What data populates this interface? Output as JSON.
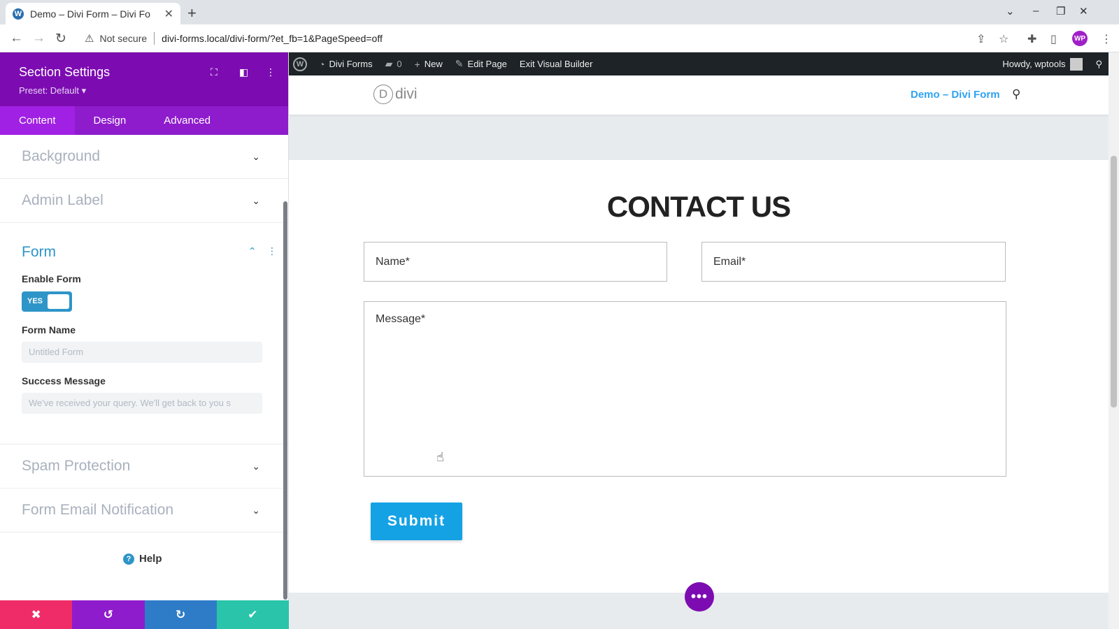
{
  "browser": {
    "tab_title": "Demo – Divi Form – Divi Fo",
    "not_secure": "Not secure",
    "url": "divi-forms.local/divi-form/?et_fb=1&PageSpeed=off",
    "profile_initials": "WP"
  },
  "panel": {
    "title": "Section Settings",
    "preset": "Preset: Default ▾",
    "tabs": [
      "Content",
      "Design",
      "Advanced"
    ],
    "sections": {
      "background": "Background",
      "admin_label": "Admin Label",
      "form": "Form",
      "spam": "Spam Protection",
      "email": "Form Email Notification"
    },
    "form": {
      "enable_label": "Enable Form",
      "enable_value": "YES",
      "name_label": "Form Name",
      "name_placeholder": "Untitled Form",
      "success_label": "Success Message",
      "success_placeholder": "We've received your query. We'll get back to you s"
    },
    "help": "Help"
  },
  "adminbar": {
    "site": "Divi Forms",
    "comments": "0",
    "new": "New",
    "edit": "Edit Page",
    "exit": "Exit Visual Builder",
    "howdy": "Howdy, wptools"
  },
  "site": {
    "logo": "divi",
    "logo_letter": "D",
    "menu_item": "Demo – Divi Form",
    "heading": "CONTACT US",
    "name_field": "Name*",
    "email_field": "Email*",
    "message_field": "Message*",
    "submit": "Submit"
  },
  "colors": {
    "divi_purple": "#7c0cb1",
    "accent_blue": "#2e95c8",
    "submit_blue": "#14a2e5",
    "cancel_red": "#ef2c68",
    "save_green": "#29c4a9"
  }
}
